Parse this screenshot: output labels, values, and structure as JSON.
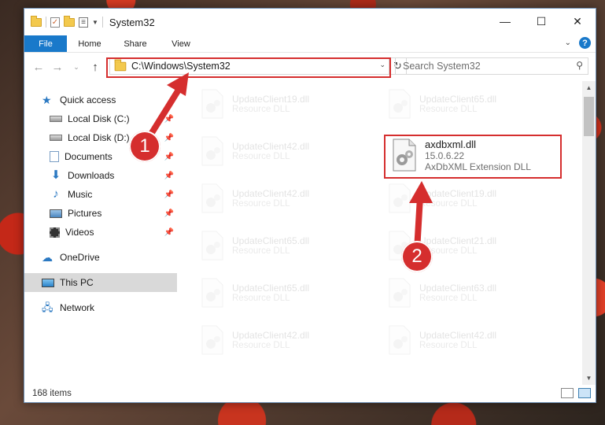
{
  "window": {
    "title": "System32"
  },
  "ribbon": {
    "tabs": [
      "File",
      "Home",
      "Share",
      "View"
    ]
  },
  "address": {
    "path": "C:\\Windows\\System32"
  },
  "search": {
    "placeholder": "Search System32"
  },
  "sidebar": {
    "items": [
      {
        "label": "Quick access",
        "icon": "star-icon"
      },
      {
        "label": "Local Disk (C:)",
        "icon": "drive-icon",
        "pinned": true
      },
      {
        "label": "Local Disk (D:)",
        "icon": "drive-icon",
        "pinned": true
      },
      {
        "label": "Documents",
        "icon": "documents-icon",
        "pinned": true
      },
      {
        "label": "Downloads",
        "icon": "download-icon",
        "pinned": true
      },
      {
        "label": "Music",
        "icon": "music-icon",
        "pinned": true
      },
      {
        "label": "Pictures",
        "icon": "pictures-icon",
        "pinned": true
      },
      {
        "label": "Videos",
        "icon": "videos-icon",
        "pinned": true
      },
      {
        "label": "OneDrive",
        "icon": "cloud-icon"
      },
      {
        "label": "This PC",
        "icon": "pc-icon",
        "selected": true
      },
      {
        "label": "Network",
        "icon": "network-icon"
      }
    ]
  },
  "files": {
    "faded": [
      {
        "name": "UpdateClient19.dll",
        "type": "Resource DLL"
      },
      {
        "name": "UpdateClient65.dll",
        "type": "Resource DLL"
      },
      {
        "name": "UpdateClient42.dll",
        "type": "Resource DLL"
      },
      {
        "name": "UpdateClient42.dll",
        "type": "Resource DLL"
      },
      {
        "name": "UpdateClient19.dll",
        "type": "Resource DLL"
      },
      {
        "name": "UpdateClient65.dll",
        "type": "Resource DLL"
      },
      {
        "name": "UpdateClient21.dll",
        "type": "Resource DLL"
      },
      {
        "name": "UpdateClient65.dll",
        "type": "Resource DLL"
      },
      {
        "name": "UpdateClient63.dll",
        "type": "Resource DLL"
      },
      {
        "name": "UpdateClient42.dll",
        "type": "Resource DLL"
      },
      {
        "name": "UpdateClient42.dll",
        "type": "Resource DLL"
      }
    ],
    "highlighted": {
      "name": "axdbxml.dll",
      "version": "15.0.6.22",
      "description": "AxDbXML Extension DLL"
    }
  },
  "status": {
    "item_count": "168 items"
  },
  "callouts": [
    "1",
    "2"
  ],
  "colors": {
    "accent": "#1979ca",
    "highlight": "#d52e2e"
  }
}
